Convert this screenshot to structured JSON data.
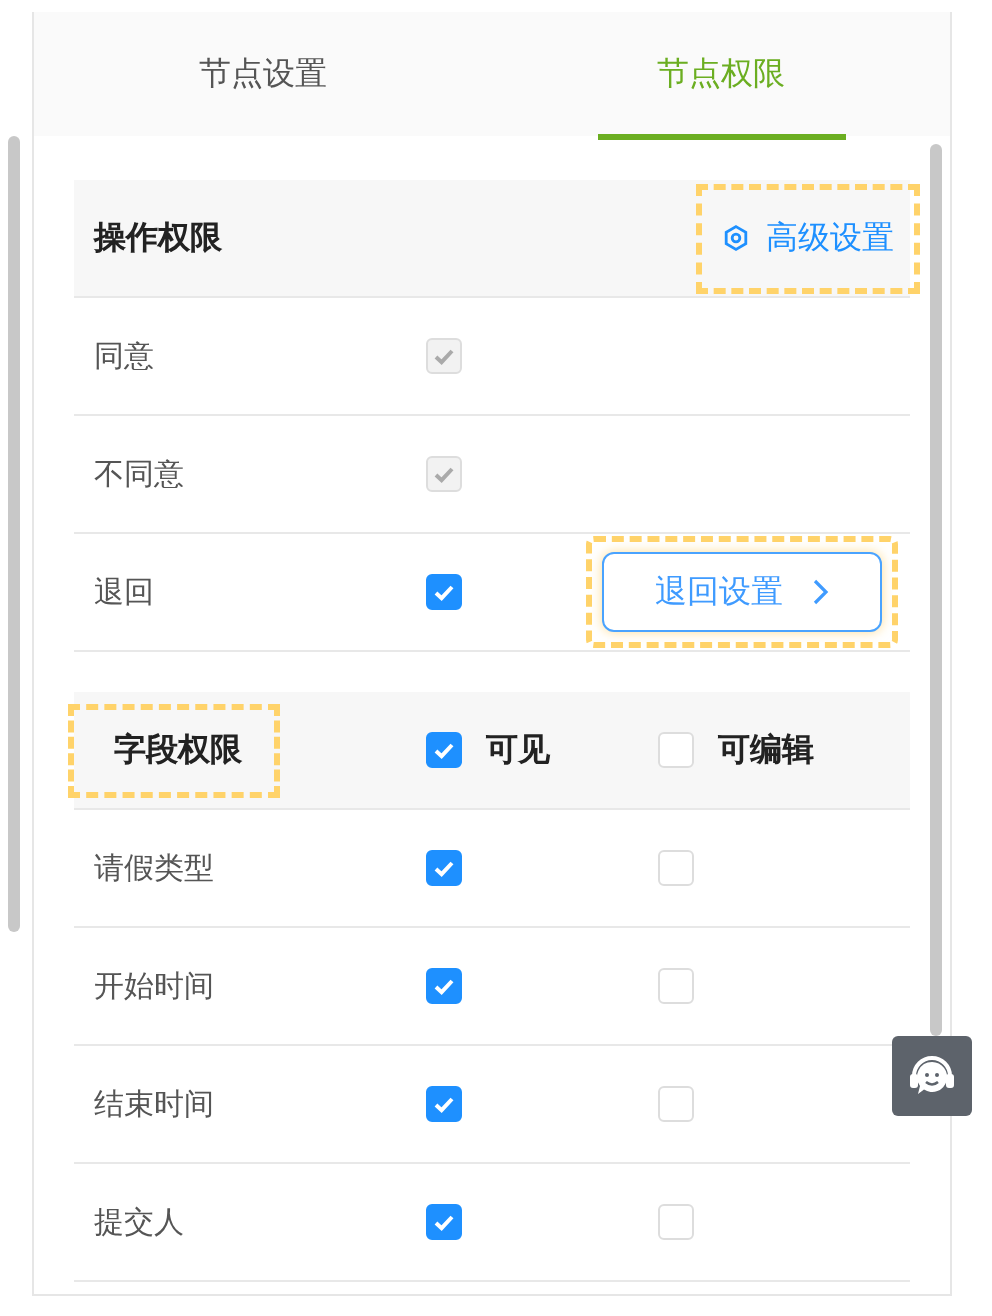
{
  "tabs": [
    {
      "label": "节点设置",
      "selected": false
    },
    {
      "label": "节点权限",
      "selected": true
    }
  ],
  "operation_permissions": {
    "title": "操作权限",
    "advanced_button": {
      "label": "高级设置",
      "highlighted": true
    },
    "rows": [
      {
        "label": "同意",
        "checked": true,
        "disabled": true
      },
      {
        "label": "不同意",
        "checked": true,
        "disabled": true
      },
      {
        "label": "退回",
        "checked": true,
        "disabled": false,
        "button": {
          "label": "退回设置",
          "highlighted": true
        }
      }
    ]
  },
  "field_permissions": {
    "title": "字段权限",
    "highlighted": true,
    "columns": [
      {
        "label": "可见",
        "checked": true
      },
      {
        "label": "可编辑",
        "checked": false
      }
    ],
    "rows": [
      {
        "label": "请假类型",
        "visible": true,
        "editable": false
      },
      {
        "label": "开始时间",
        "visible": true,
        "editable": false
      },
      {
        "label": "结束时间",
        "visible": true,
        "editable": false
      },
      {
        "label": "提交人",
        "visible": true,
        "editable": false
      }
    ]
  }
}
